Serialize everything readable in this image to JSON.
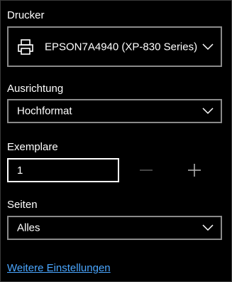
{
  "printer": {
    "label": "Drucker",
    "selected": "EPSON7A4940 (XP-830 Series)",
    "icon": "printer-icon"
  },
  "orientation": {
    "label": "Ausrichtung",
    "selected": "Hochformat"
  },
  "copies": {
    "label": "Exemplare",
    "value": "1",
    "decrement_icon": "minus-icon",
    "increment_icon": "plus-icon"
  },
  "pages": {
    "label": "Seiten",
    "selected": "Alles"
  },
  "more_settings": {
    "label": "Weitere Einstellungen"
  },
  "colors": {
    "background": "#000000",
    "text": "#ffffff",
    "border": "#8a8a8a",
    "link": "#4aa6ff",
    "disabled": "#5a5a5a"
  }
}
